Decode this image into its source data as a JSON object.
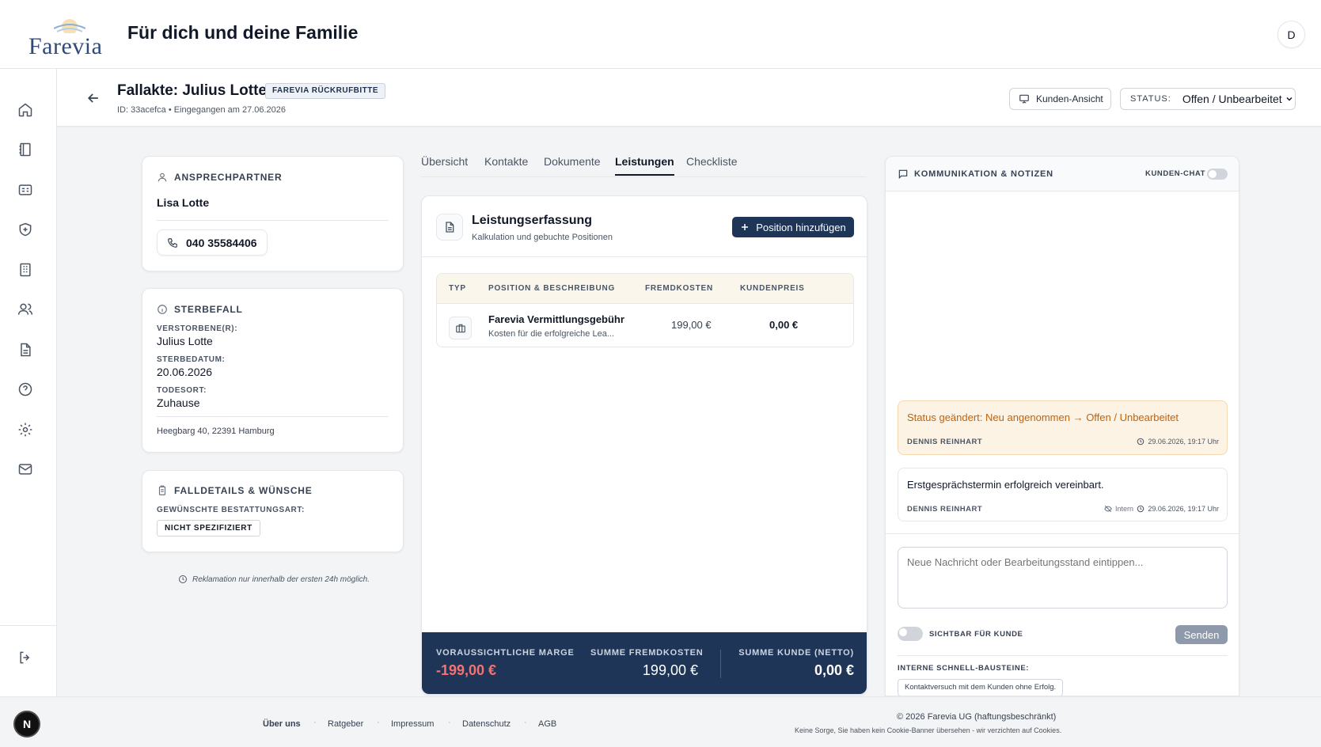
{
  "header": {
    "logo_text": "Farevia",
    "title": "Für dich und deine Familie",
    "avatar_initial": "D"
  },
  "sidebar": {
    "icons": [
      "home-icon",
      "book-icon",
      "id-card-icon",
      "shield-plus-icon",
      "building-icon",
      "users-icon",
      "document-icon",
      "help-icon",
      "settings-icon",
      "mail-icon"
    ],
    "logout_icon": "logout-icon"
  },
  "case": {
    "title": "Fallakte: Julius Lotte",
    "badge": "FAREVIA RÜCKRUFBITTE",
    "subtitle": "ID: 33acefca • Eingegangen am 27.06.2026",
    "customer_view_label": "Kunden-Ansicht",
    "status_label": "STATUS:",
    "status_value": "Offen / Unbearbeitet"
  },
  "contact_card": {
    "heading": "ANSPRECHPARTNER",
    "name": "Lisa Lotte",
    "phone": "040 35584406"
  },
  "death_card": {
    "heading": "STERBEFALL",
    "deceased_label": "VERSTORBENE(R):",
    "deceased_value": "Julius Lotte",
    "date_label": "STERBEDATUM:",
    "date_value": "20.06.2026",
    "place_label": "TODESORT:",
    "place_value": "Zuhause",
    "address": "Heegbarg 40, 22391 Hamburg"
  },
  "details_card": {
    "heading": "FALLDETAILS & WÜNSCHE",
    "burial_label": "GEWÜNSCHTE BESTATTUNGSART:",
    "burial_value": "NICHT SPEZIFIZIERT"
  },
  "reklamation_note": "Reklamation nur innerhalb der ersten 24h möglich.",
  "tabs": [
    {
      "label": "Übersicht",
      "active": false
    },
    {
      "label": "Kontakte",
      "active": false
    },
    {
      "label": "Dokumente",
      "active": false
    },
    {
      "label": "Leistungen",
      "active": true
    },
    {
      "label": "Checkliste",
      "active": false
    }
  ],
  "services": {
    "title": "Leistungserfassung",
    "subtitle": "Kalkulation und gebuchte Positionen",
    "add_button": "Position hinzufügen",
    "columns": [
      "TYP",
      "POSITION & BESCHREIBUNG",
      "FREMDKOSTEN",
      "KUNDENPREIS"
    ],
    "rows": [
      {
        "name": "Farevia Vermittlungsgebühr",
        "description": "Kosten für die erfolgreiche Lea...",
        "fremdkosten": "199,00 €",
        "kundenpreis": "0,00 €"
      }
    ],
    "summary": {
      "margin_label": "VORAUSSICHTLICHE MARGE",
      "margin_value": "-199,00 €",
      "fremd_label": "SUMME FREMDKOSTEN",
      "fremd_value": "199,00 €",
      "kunde_label": "SUMME KUNDE (NETTO)",
      "kunde_value": "0,00 €"
    },
    "colors": {
      "navy": "#1e3558",
      "negative": "#f87171"
    }
  },
  "communication": {
    "title": "KOMMUNIKATION & NOTIZEN",
    "chat_label": "KUNDEN-CHAT",
    "messages": [
      {
        "text": "Status geändert: Neu angenommen → Offen / Unbearbeitet",
        "author": "DENNIS REINHART",
        "time": "29.06.2026, 19:17 Uhr"
      },
      {
        "text": "Erstgesprächstermin erfolgreich vereinbart.",
        "author": "DENNIS REINHART",
        "visibility": "Intern",
        "time": "29.06.2026, 19:17 Uhr"
      }
    ],
    "compose_placeholder": "Neue Nachricht oder Bearbeitungsstand eintippen...",
    "visible_label": "SICHTBAR FÜR KUNDE",
    "send_button": "Senden",
    "quick_label": "INTERNE SCHNELL-BAUSTEINE:",
    "quick_items": [
      "Kontaktversuch mit dem Kunden ohne Erfolg."
    ]
  },
  "footer": {
    "badge": "N",
    "links": [
      "Über uns",
      "Ratgeber",
      "Impressum",
      "Datenschutz",
      "AGB"
    ],
    "copyright": "© 2026 Farevia UG (haftungsbeschränkt)",
    "cookie_note": "Keine Sorge, Sie haben kein Cookie-Banner übersehen - wir verzichten auf Cookies."
  }
}
